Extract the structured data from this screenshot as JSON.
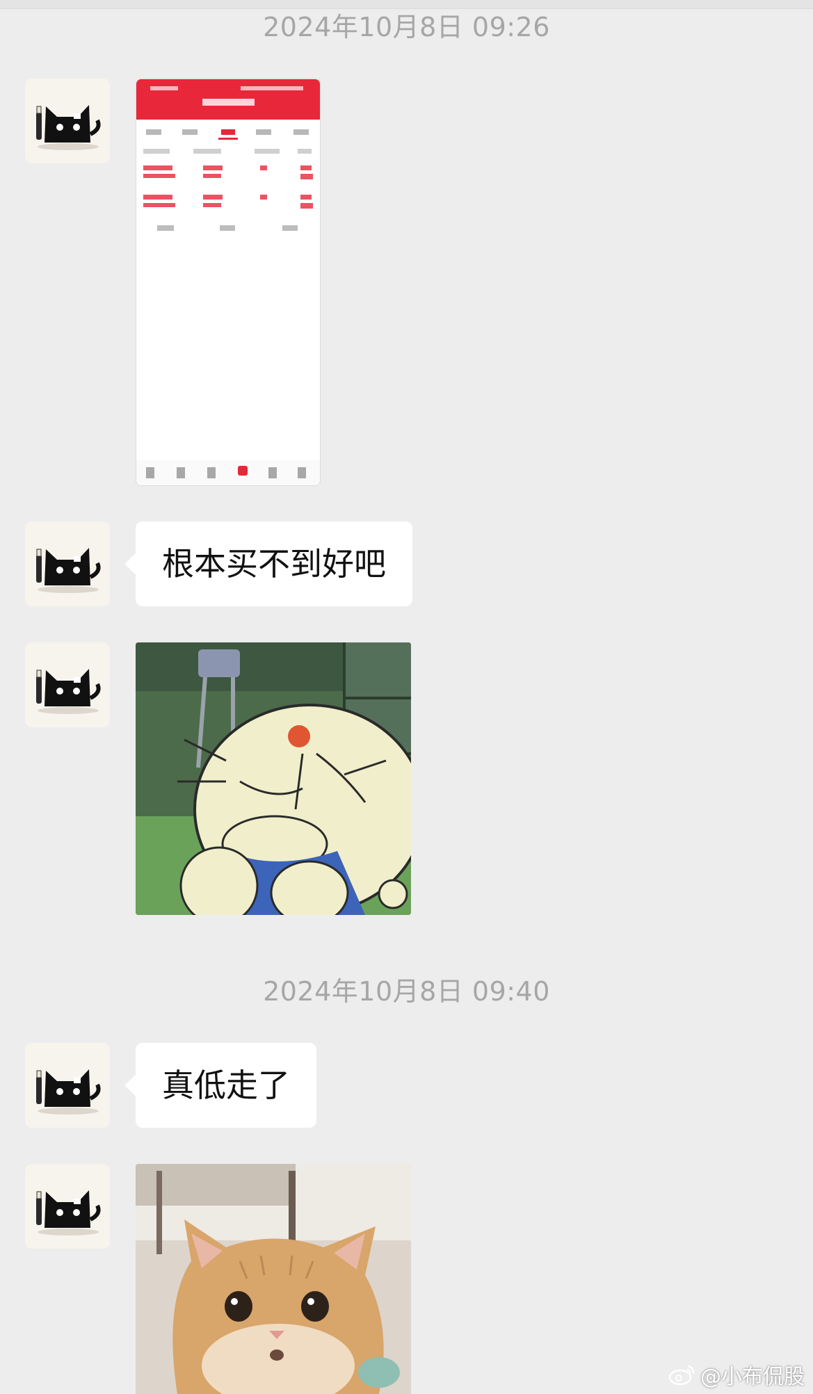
{
  "chat": {
    "timestamps": [
      "2024年10月8日 09:26",
      "2024年10月8日 09:40"
    ],
    "messages": [
      {
        "type": "image",
        "image": "screenshot-stock-app"
      },
      {
        "type": "text",
        "text": "根本买不到好吧"
      },
      {
        "type": "image",
        "image": "doraemon-sticker"
      },
      {
        "type": "text",
        "text": "真低走了"
      },
      {
        "type": "image",
        "image": "orange-cat-sticker"
      }
    ]
  },
  "avatar": {
    "image": "black-cat-avatar"
  },
  "watermark": {
    "text": "@小布侃股",
    "icon": "weibo-icon"
  },
  "colors": {
    "background": "#ededed",
    "bubble": "#ffffff",
    "app_header_red": "#e8273a",
    "timestamp_text": "#a6a6a6"
  }
}
